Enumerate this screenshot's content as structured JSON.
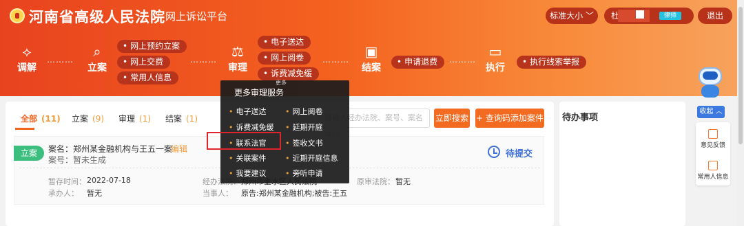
{
  "header": {
    "court_name": "河南省高级人民法院",
    "platform": "网上诉讼平台",
    "font_size_label": "标准大小 ﹀",
    "user_prefix": "杜",
    "lawyer_badge": "律师",
    "logout_label": "退出"
  },
  "process": {
    "stages": [
      {
        "label": "调解",
        "icon": "handshake-icon",
        "glyph": "⟡"
      },
      {
        "label": "立案",
        "icon": "case-filing-icon",
        "glyph": "⌕"
      },
      {
        "label": "审理",
        "icon": "gavel-icon",
        "glyph": "⚖"
      },
      {
        "label": "结案",
        "icon": "clipboard-icon",
        "glyph": "▣"
      },
      {
        "label": "执行",
        "icon": "monitor-icon",
        "glyph": "▭"
      }
    ],
    "dots": "………",
    "filing_links": [
      "网上预约立案",
      "网上交费",
      "常用人信息"
    ],
    "trial_links": [
      "电子送达",
      "网上阅卷",
      "诉费减免缓"
    ],
    "closing_links": [
      "申请退费"
    ],
    "execution_links": [
      "执行线索举报"
    ]
  },
  "tabs": [
    {
      "label": "全部",
      "count": "(11)"
    },
    {
      "label": "立案",
      "count": "(9)"
    },
    {
      "label": "审理",
      "count": "(1)"
    },
    {
      "label": "结案",
      "count": "(1)"
    }
  ],
  "search": {
    "placeholder": "请输入经办法院、案号、案名进行",
    "search_label": "立即搜索",
    "add_case_label": "+ 查询码添加案件"
  },
  "case": {
    "tag": "立案",
    "name": "案名：郑州某金融机构与王五一案",
    "edit_label": "编辑",
    "case_no": "案号：暂未生成",
    "status": "待提交",
    "fields": {
      "saved_time_label": "暂存时间：",
      "saved_time": "2022-07-18",
      "handler_label": "承办人：",
      "handler": "暂无",
      "court_label": "经办法院：",
      "court": "郑州市金水区人民法院",
      "original_court_label": "原审法院：",
      "original_court": "暂无",
      "parties_label": "当事人：",
      "parties": "原告:郑州某金融机构;被告:王五"
    }
  },
  "todo": {
    "title": "待办事项"
  },
  "float_bar": {
    "collapse_label": "收起 ︿",
    "feedback_label": "意见反馈",
    "contacts_label": "常用人信息"
  },
  "dropdown": {
    "more_tag": "更多",
    "title": "更多审理服务",
    "items": [
      "电子送达",
      "网上阅卷",
      "诉费减免缓",
      "延期开庭",
      "联系法官",
      "签收文书",
      "关联案件",
      "近期开庭信息",
      "我要建议",
      "旁听申请"
    ]
  },
  "colors": {
    "brand_orange": "#f36b21",
    "header_start": "#e8431f",
    "status_blue": "#3f6fd8",
    "tag_green": "#3cbf7e",
    "highlight_red": "#e0242c"
  }
}
